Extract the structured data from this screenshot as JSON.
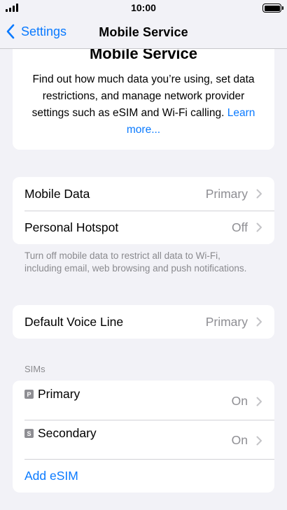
{
  "status": {
    "time": "10:00"
  },
  "nav": {
    "back_label": "Settings",
    "title": "Mobile Service"
  },
  "hero": {
    "title": "Mobile Service",
    "description": "Find out how much data you’re using, set data restrictions, and manage network provider settings such as eSIM and Wi-Fi calling.",
    "link": "Learn more..."
  },
  "data_section": {
    "rows": [
      {
        "label": "Mobile Data",
        "value": "Primary"
      },
      {
        "label": "Personal Hotspot",
        "value": "Off"
      }
    ],
    "footer": "Turn off mobile data to restrict all data to Wi-Fi, including email, web browsing and push notifications."
  },
  "voice_section": {
    "rows": [
      {
        "label": "Default Voice Line",
        "value": "Primary"
      }
    ]
  },
  "sims_section": {
    "header": "SIMs",
    "rows": [
      {
        "badge": "P",
        "label": "Primary",
        "value": "On"
      },
      {
        "badge": "S",
        "label": "Secondary",
        "value": "On"
      }
    ],
    "add_label": "Add eSIM"
  },
  "colors": {
    "accent": "#0a7aff",
    "background": "#f2f2f7",
    "secondary_text": "#8e8e93"
  },
  "icons": {
    "back": "chevron-left-icon",
    "disclosure": "chevron-right-icon",
    "signal": "signal-icon",
    "battery": "battery-icon"
  }
}
